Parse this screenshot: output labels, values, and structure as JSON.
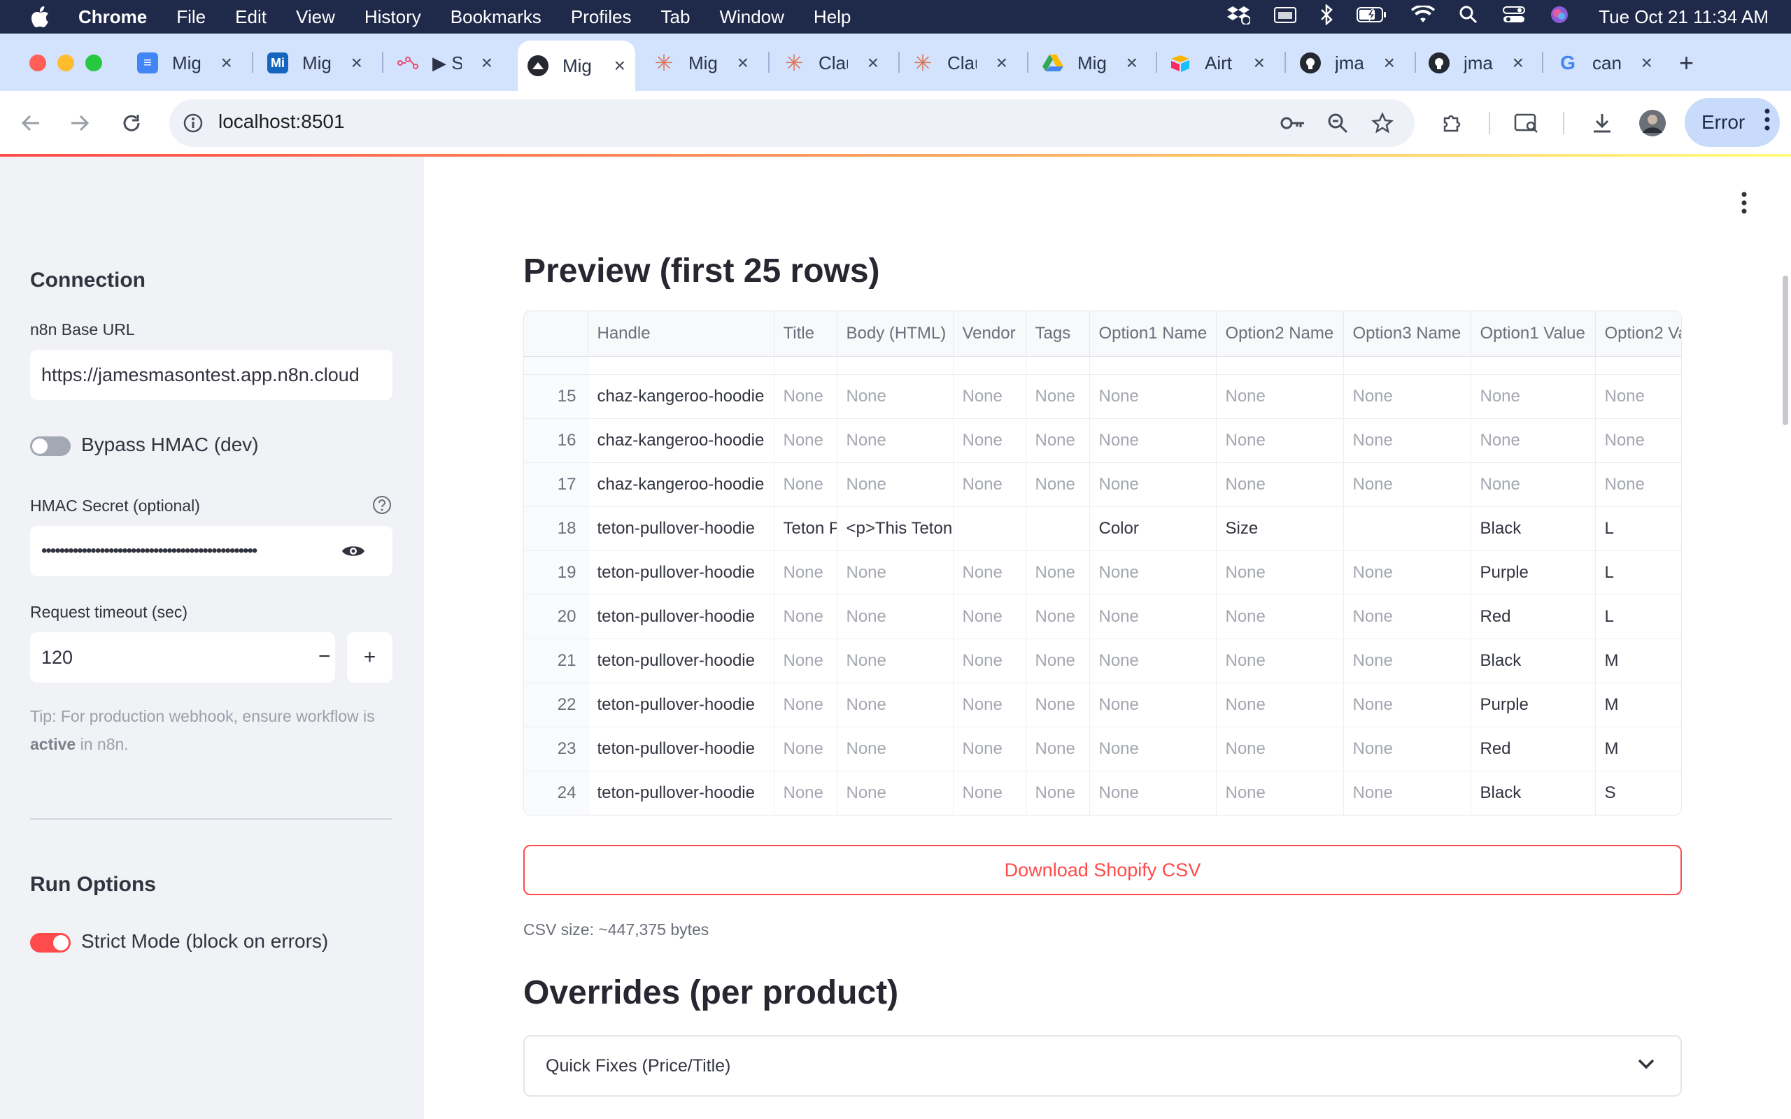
{
  "menubar": {
    "app": "Chrome",
    "items": [
      "File",
      "Edit",
      "View",
      "History",
      "Bookmarks",
      "Profiles",
      "Tab",
      "Window",
      "Help"
    ],
    "clock": "Tue Oct 21  11:34 AM"
  },
  "tabs": [
    {
      "label": "Mig",
      "icon": "docs-icon",
      "color": "#4285f4"
    },
    {
      "label": "Mig",
      "icon": "mi-icon",
      "color": "#1565c0"
    },
    {
      "label": "▶ S",
      "icon": "flow-icon",
      "color": "#ea4b71"
    },
    {
      "label": "Mig",
      "icon": "streamlit-icon",
      "color": "#262730",
      "active": true
    },
    {
      "label": "Mig",
      "icon": "claude-icon",
      "color": "#d97757"
    },
    {
      "label": "Clau",
      "icon": "claude-icon",
      "color": "#d97757"
    },
    {
      "label": "Clau",
      "icon": "claude-icon",
      "color": "#d97757"
    },
    {
      "label": "Mig",
      "icon": "drive-icon",
      "color": "#34a853"
    },
    {
      "label": "Airt",
      "icon": "airtable-icon",
      "color": "#fcb400"
    },
    {
      "label": "jma",
      "icon": "github-icon",
      "color": "#24292f"
    },
    {
      "label": "jma",
      "icon": "github-icon",
      "color": "#24292f"
    },
    {
      "label": "can",
      "icon": "google-icon",
      "color": "#4285f4"
    }
  ],
  "toolbar": {
    "url": "localhost:8501",
    "error_label": "Error"
  },
  "sidebar": {
    "connection_heading": "Connection",
    "base_url_label": "n8n Base URL",
    "base_url_value": "https://jamesmasontest.app.n8n.cloud",
    "bypass_label": "Bypass HMAC (dev)",
    "bypass_on": false,
    "hmac_label": "HMAC Secret (optional)",
    "hmac_value": "••••••••••••••••••••••••••••••••••••••••••••••••",
    "timeout_label": "Request timeout (sec)",
    "timeout_value": "120",
    "stepper_minus": "−",
    "stepper_plus": "+",
    "tip_text": "Tip: For production webhook, ensure workflow is",
    "tip_bold": "active",
    "tip_tail": " in n8n.",
    "run_heading": "Run Options",
    "strict_label": "Strict Mode (block on errors)",
    "strict_on": true
  },
  "main": {
    "preview_heading": "Preview (first 25 rows)",
    "download_label": "Download Shopify CSV",
    "csv_size": "CSV size: ~447,375 bytes",
    "overrides_heading": "Overrides (per product)",
    "expander_label": "Quick Fixes (Price/Title)"
  },
  "table": {
    "columns": [
      "",
      "Handle",
      "Title",
      "Body (HTML)",
      "Vendor",
      "Tags",
      "Option1 Name",
      "Option2 Name",
      "Option3 Name",
      "Option1 Value",
      "Option2 Va"
    ],
    "rows": [
      [
        "15",
        "chaz-kangeroo-hoodie",
        "None",
        "None",
        "None",
        "None",
        "None",
        "None",
        "None",
        "None",
        "None"
      ],
      [
        "16",
        "chaz-kangeroo-hoodie",
        "None",
        "None",
        "None",
        "None",
        "None",
        "None",
        "None",
        "None",
        "None"
      ],
      [
        "17",
        "chaz-kangeroo-hoodie",
        "None",
        "None",
        "None",
        "None",
        "None",
        "None",
        "None",
        "None",
        "None"
      ],
      [
        "18",
        "teton-pullover-hoodie",
        "Teton P",
        "<p>This Teton",
        "",
        "",
        "Color",
        "Size",
        "",
        "Black",
        "L"
      ],
      [
        "19",
        "teton-pullover-hoodie",
        "None",
        "None",
        "None",
        "None",
        "None",
        "None",
        "None",
        "Purple",
        "L"
      ],
      [
        "20",
        "teton-pullover-hoodie",
        "None",
        "None",
        "None",
        "None",
        "None",
        "None",
        "None",
        "Red",
        "L"
      ],
      [
        "21",
        "teton-pullover-hoodie",
        "None",
        "None",
        "None",
        "None",
        "None",
        "None",
        "None",
        "Black",
        "M"
      ],
      [
        "22",
        "teton-pullover-hoodie",
        "None",
        "None",
        "None",
        "None",
        "None",
        "None",
        "None",
        "Purple",
        "M"
      ],
      [
        "23",
        "teton-pullover-hoodie",
        "None",
        "None",
        "None",
        "None",
        "None",
        "None",
        "None",
        "Red",
        "M"
      ],
      [
        "24",
        "teton-pullover-hoodie",
        "None",
        "None",
        "None",
        "None",
        "None",
        "None",
        "None",
        "Black",
        "S"
      ]
    ]
  },
  "colors": {
    "accent": "#ff4b4b",
    "sidebar_bg": "#f0f2f6",
    "tabstrip_bg": "#d3e2fd",
    "menubar_bg": "#1f2a4a"
  }
}
